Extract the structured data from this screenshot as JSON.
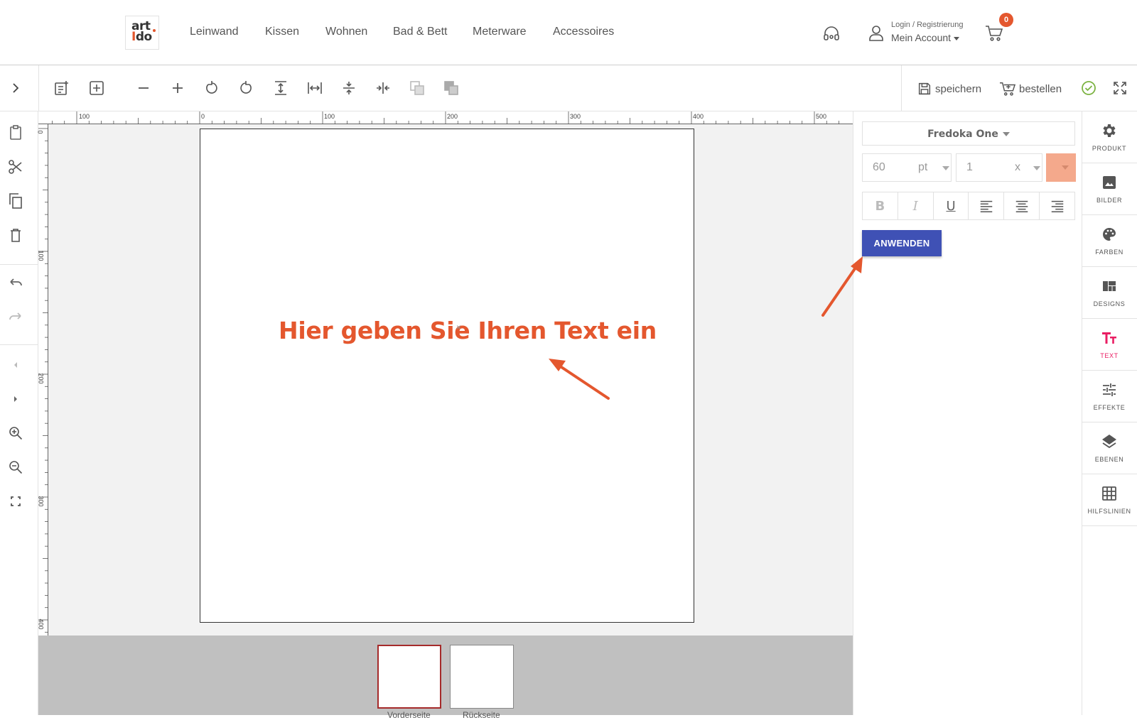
{
  "header": {
    "logo_line1": "art",
    "logo_line2_i": "I",
    "logo_line2_rest": "do",
    "nav": [
      "Leinwand",
      "Kissen",
      "Wohnen",
      "Bad & Bett",
      "Meterware",
      "Accessoires"
    ],
    "login_label": "Login / Registrierung",
    "account_label": "Mein Account",
    "cart_count": "0"
  },
  "toolbar": {
    "save_label": "speichern",
    "order_label": "bestellen",
    "icons": [
      "add-page-icon",
      "add-box-icon",
      "minus-icon",
      "plus-icon",
      "rotate-left-icon",
      "rotate-right-icon",
      "align-vertical-icon",
      "align-horizontal-icon",
      "compress-vertical-icon",
      "compress-horizontal-icon",
      "send-back-icon",
      "bring-front-icon"
    ]
  },
  "left_bar": {
    "icons": [
      "paste-icon",
      "cut-icon",
      "copy-icon",
      "delete-icon",
      "undo-icon",
      "redo-icon",
      "previous-icon",
      "next-icon",
      "zoom-in-icon",
      "zoom-out-icon",
      "fullscreen-icon"
    ]
  },
  "rulers": {
    "top_labels": [
      "100",
      "0",
      "100",
      "200",
      "300",
      "400",
      "500"
    ],
    "left_labels": [
      "0",
      "100",
      "200",
      "300",
      "400"
    ]
  },
  "canvas": {
    "text": "Hier geben Sie Ihren Text ein",
    "text_color": "#e4572e",
    "center_mark": "×"
  },
  "pages": {
    "front_label": "Vorderseite",
    "back_label": "Rückseite"
  },
  "text_panel": {
    "font_name": "Fredoka One",
    "font_size": "60",
    "font_size_unit": "pt",
    "line_height": "1",
    "line_height_unit": "x",
    "text_color": "#f4a98c",
    "format_buttons": [
      "B",
      "I",
      "U",
      "align-left",
      "align-center",
      "align-right"
    ],
    "apply_label": "ANWENDEN"
  },
  "side_tabs": [
    {
      "label": "PRODUKT",
      "icon": "gear-icon"
    },
    {
      "label": "BILDER",
      "icon": "image-icon"
    },
    {
      "label": "FARBEN",
      "icon": "palette-icon"
    },
    {
      "label": "DESIGNS",
      "icon": "designs-icon"
    },
    {
      "label": "TEXT",
      "icon": "text-icon",
      "active": true
    },
    {
      "label": "EFFEKTE",
      "icon": "sliders-icon"
    },
    {
      "label": "EBENEN",
      "icon": "layers-icon"
    },
    {
      "label": "HILFSLINIEN",
      "icon": "grid-icon"
    }
  ],
  "colors": {
    "accent": "#e4572e",
    "apply_button": "#3f51b5",
    "active_tab": "#e91e63",
    "confirm": "#7cb342"
  }
}
